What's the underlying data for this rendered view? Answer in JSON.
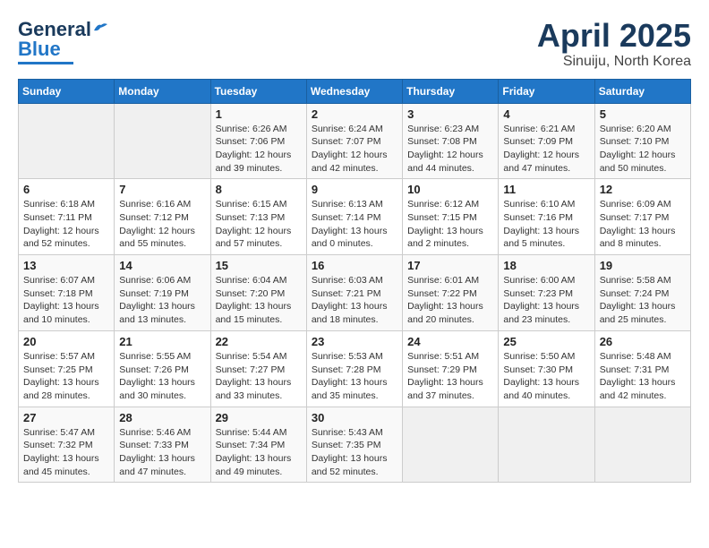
{
  "header": {
    "logo_line1": "General",
    "logo_line2": "Blue",
    "month": "April 2025",
    "location": "Sinuiju, North Korea"
  },
  "weekdays": [
    "Sunday",
    "Monday",
    "Tuesday",
    "Wednesday",
    "Thursday",
    "Friday",
    "Saturday"
  ],
  "weeks": [
    [
      {
        "day": "",
        "detail": ""
      },
      {
        "day": "",
        "detail": ""
      },
      {
        "day": "1",
        "detail": "Sunrise: 6:26 AM\nSunset: 7:06 PM\nDaylight: 12 hours\nand 39 minutes."
      },
      {
        "day": "2",
        "detail": "Sunrise: 6:24 AM\nSunset: 7:07 PM\nDaylight: 12 hours\nand 42 minutes."
      },
      {
        "day": "3",
        "detail": "Sunrise: 6:23 AM\nSunset: 7:08 PM\nDaylight: 12 hours\nand 44 minutes."
      },
      {
        "day": "4",
        "detail": "Sunrise: 6:21 AM\nSunset: 7:09 PM\nDaylight: 12 hours\nand 47 minutes."
      },
      {
        "day": "5",
        "detail": "Sunrise: 6:20 AM\nSunset: 7:10 PM\nDaylight: 12 hours\nand 50 minutes."
      }
    ],
    [
      {
        "day": "6",
        "detail": "Sunrise: 6:18 AM\nSunset: 7:11 PM\nDaylight: 12 hours\nand 52 minutes."
      },
      {
        "day": "7",
        "detail": "Sunrise: 6:16 AM\nSunset: 7:12 PM\nDaylight: 12 hours\nand 55 minutes."
      },
      {
        "day": "8",
        "detail": "Sunrise: 6:15 AM\nSunset: 7:13 PM\nDaylight: 12 hours\nand 57 minutes."
      },
      {
        "day": "9",
        "detail": "Sunrise: 6:13 AM\nSunset: 7:14 PM\nDaylight: 13 hours\nand 0 minutes."
      },
      {
        "day": "10",
        "detail": "Sunrise: 6:12 AM\nSunset: 7:15 PM\nDaylight: 13 hours\nand 2 minutes."
      },
      {
        "day": "11",
        "detail": "Sunrise: 6:10 AM\nSunset: 7:16 PM\nDaylight: 13 hours\nand 5 minutes."
      },
      {
        "day": "12",
        "detail": "Sunrise: 6:09 AM\nSunset: 7:17 PM\nDaylight: 13 hours\nand 8 minutes."
      }
    ],
    [
      {
        "day": "13",
        "detail": "Sunrise: 6:07 AM\nSunset: 7:18 PM\nDaylight: 13 hours\nand 10 minutes."
      },
      {
        "day": "14",
        "detail": "Sunrise: 6:06 AM\nSunset: 7:19 PM\nDaylight: 13 hours\nand 13 minutes."
      },
      {
        "day": "15",
        "detail": "Sunrise: 6:04 AM\nSunset: 7:20 PM\nDaylight: 13 hours\nand 15 minutes."
      },
      {
        "day": "16",
        "detail": "Sunrise: 6:03 AM\nSunset: 7:21 PM\nDaylight: 13 hours\nand 18 minutes."
      },
      {
        "day": "17",
        "detail": "Sunrise: 6:01 AM\nSunset: 7:22 PM\nDaylight: 13 hours\nand 20 minutes."
      },
      {
        "day": "18",
        "detail": "Sunrise: 6:00 AM\nSunset: 7:23 PM\nDaylight: 13 hours\nand 23 minutes."
      },
      {
        "day": "19",
        "detail": "Sunrise: 5:58 AM\nSunset: 7:24 PM\nDaylight: 13 hours\nand 25 minutes."
      }
    ],
    [
      {
        "day": "20",
        "detail": "Sunrise: 5:57 AM\nSunset: 7:25 PM\nDaylight: 13 hours\nand 28 minutes."
      },
      {
        "day": "21",
        "detail": "Sunrise: 5:55 AM\nSunset: 7:26 PM\nDaylight: 13 hours\nand 30 minutes."
      },
      {
        "day": "22",
        "detail": "Sunrise: 5:54 AM\nSunset: 7:27 PM\nDaylight: 13 hours\nand 33 minutes."
      },
      {
        "day": "23",
        "detail": "Sunrise: 5:53 AM\nSunset: 7:28 PM\nDaylight: 13 hours\nand 35 minutes."
      },
      {
        "day": "24",
        "detail": "Sunrise: 5:51 AM\nSunset: 7:29 PM\nDaylight: 13 hours\nand 37 minutes."
      },
      {
        "day": "25",
        "detail": "Sunrise: 5:50 AM\nSunset: 7:30 PM\nDaylight: 13 hours\nand 40 minutes."
      },
      {
        "day": "26",
        "detail": "Sunrise: 5:48 AM\nSunset: 7:31 PM\nDaylight: 13 hours\nand 42 minutes."
      }
    ],
    [
      {
        "day": "27",
        "detail": "Sunrise: 5:47 AM\nSunset: 7:32 PM\nDaylight: 13 hours\nand 45 minutes."
      },
      {
        "day": "28",
        "detail": "Sunrise: 5:46 AM\nSunset: 7:33 PM\nDaylight: 13 hours\nand 47 minutes."
      },
      {
        "day": "29",
        "detail": "Sunrise: 5:44 AM\nSunset: 7:34 PM\nDaylight: 13 hours\nand 49 minutes."
      },
      {
        "day": "30",
        "detail": "Sunrise: 5:43 AM\nSunset: 7:35 PM\nDaylight: 13 hours\nand 52 minutes."
      },
      {
        "day": "",
        "detail": ""
      },
      {
        "day": "",
        "detail": ""
      },
      {
        "day": "",
        "detail": ""
      }
    ]
  ]
}
